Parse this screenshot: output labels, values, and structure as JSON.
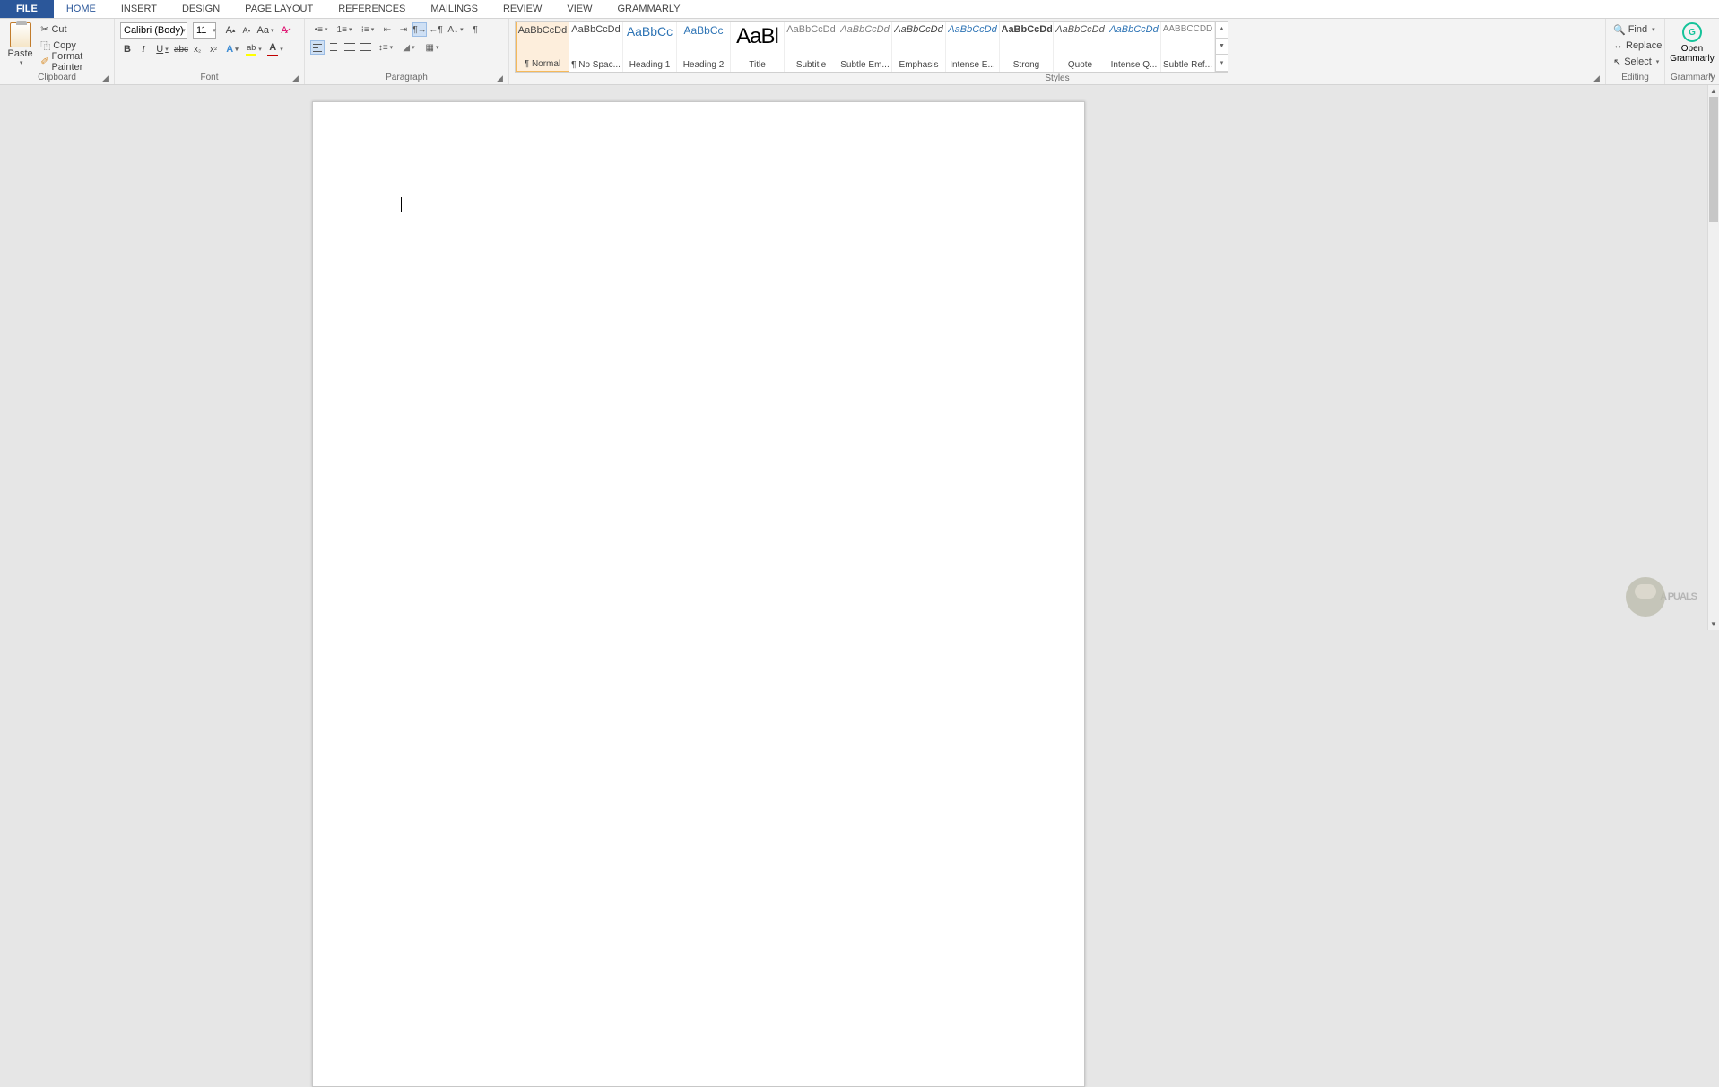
{
  "tabs": [
    "FILE",
    "HOME",
    "INSERT",
    "DESIGN",
    "PAGE LAYOUT",
    "REFERENCES",
    "MAILINGS",
    "REVIEW",
    "VIEW",
    "GRAMMARLY"
  ],
  "activeTab": "HOME",
  "clipboard": {
    "groupName": "Clipboard",
    "paste": "Paste",
    "cut": "Cut",
    "copy": "Copy",
    "formatPainter": "Format Painter"
  },
  "font": {
    "groupName": "Font",
    "name": "Calibri (Body)",
    "size": "11"
  },
  "paragraph": {
    "groupName": "Paragraph"
  },
  "styles": {
    "groupName": "Styles",
    "items": [
      {
        "preview": "AaBbCcDd",
        "label": "¶ Normal",
        "selected": true,
        "style": ""
      },
      {
        "preview": "AaBbCcDd",
        "label": "¶ No Spac...",
        "style": ""
      },
      {
        "preview": "AaBbCc",
        "label": "Heading 1",
        "style": "color:#2e74b5;font-size:14px;"
      },
      {
        "preview": "AaBbCc",
        "label": "Heading 2",
        "style": "color:#2e74b5;font-size:12px;"
      },
      {
        "preview": "AaBl",
        "label": "Title",
        "style": "font-size:24px;color:#000;letter-spacing:-1px;"
      },
      {
        "preview": "AaBbCcDd",
        "label": "Subtitle",
        "style": "color:#808080;"
      },
      {
        "preview": "AaBbCcDd",
        "label": "Subtle Em...",
        "style": "font-style:italic;color:#808080;"
      },
      {
        "preview": "AaBbCcDd",
        "label": "Emphasis",
        "style": "font-style:italic;"
      },
      {
        "preview": "AaBbCcDd",
        "label": "Intense E...",
        "style": "font-style:italic;color:#2e74b5;"
      },
      {
        "preview": "AaBbCcDd",
        "label": "Strong",
        "style": "font-weight:bold;"
      },
      {
        "preview": "AaBbCcDd",
        "label": "Quote",
        "style": "font-style:italic;color:#555;"
      },
      {
        "preview": "AaBbCcDd",
        "label": "Intense Q...",
        "style": "font-style:italic;color:#2e74b5;"
      },
      {
        "preview": "AABBCCDD",
        "label": "Subtle Ref...",
        "style": "color:#808080;font-size:10px;"
      }
    ]
  },
  "editing": {
    "groupName": "Editing",
    "find": "Find",
    "replace": "Replace",
    "select": "Select"
  },
  "grammarly": {
    "groupName": "Grammarly",
    "open": "Open Grammarly"
  },
  "watermark": "A  PUALS"
}
